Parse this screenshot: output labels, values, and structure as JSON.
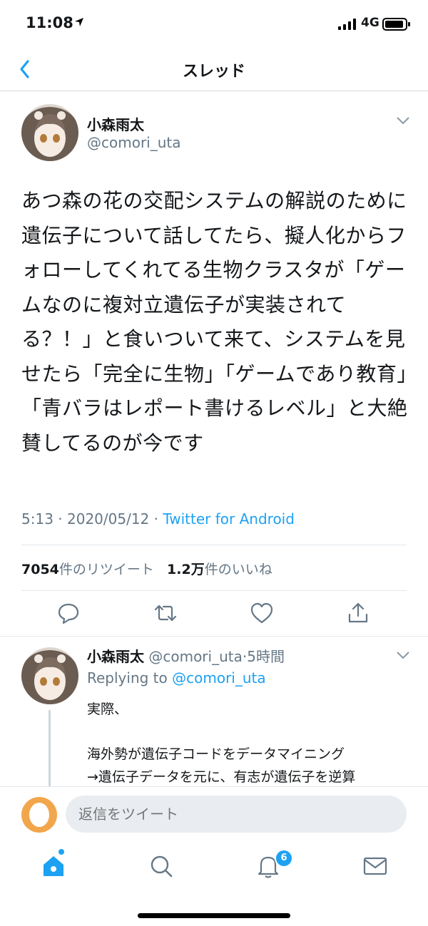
{
  "status_bar": {
    "time": "11:08",
    "network": "4G"
  },
  "nav": {
    "title": "スレッド"
  },
  "main_tweet": {
    "author_name": "小森雨太",
    "handle": "@comori_uta",
    "text": "あつ森の花の交配システムの解説のために遺伝子について話してたら、擬人化からフォローしてくれてる生物クラスタが「ゲームなのに複対立遺伝子が実装されてる？！」と食いついて来て、システムを見せたら「完全に生物」「ゲームであり教育」「青バラはレポート書けるレベル」と大絶賛してるのが今です",
    "time": "5:13",
    "date": "2020/05/12",
    "separator": "·",
    "app": "Twitter for Android",
    "retweets_count": "7054",
    "retweets_label": "件のリツイート",
    "likes_count": "1.2万",
    "likes_label": "件のいいね"
  },
  "reply_tweet": {
    "author_name": "小森雨太",
    "handle": "@comori_uta",
    "time_ago": "5時間",
    "separator": "·",
    "replying_prefix": "Replying to",
    "replying_to": "@comori_uta",
    "text": "実際、\n\n海外勢が遺伝子コードをデータマイニング\n→遺伝子データを元に、有志が遺伝子を逆算"
  },
  "composer": {
    "placeholder": "返信をツイート"
  },
  "tabbar": {
    "notifications_badge": "6"
  },
  "colors": {
    "accent": "#1da1f2",
    "secondary_text": "#657786",
    "divider": "#e1e8ed"
  }
}
